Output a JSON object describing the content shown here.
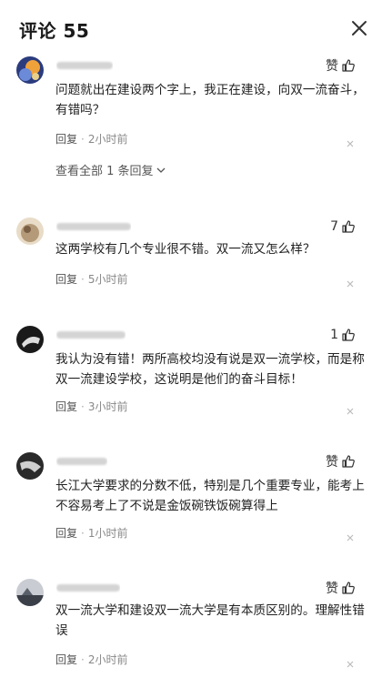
{
  "header": {
    "title": "评论 55"
  },
  "reply_label": "回复",
  "comments": [
    {
      "likes": "赞",
      "text": "问题就出在建设两个字上，我正在建设，向双一流奋斗，有错吗？",
      "time": "2小时前",
      "view_all": "查看全部 1 条回复"
    },
    {
      "likes": "7",
      "text": "这两学校有几个专业很不错。双一流又怎么样？",
      "time": "5小时前"
    },
    {
      "likes": "1",
      "text": "我认为没有错！两所高校均没有说是双一流学校，而是称双一流建设学校，这说明是他们的奋斗目标！",
      "time": "3小时前"
    },
    {
      "likes": "赞",
      "text": "长江大学要求的分数不低，特别是几个重要专业，能考上不容易考上了不说是金饭碗铁饭碗算得上",
      "time": "1小时前"
    },
    {
      "likes": "赞",
      "text": "双一流大学和建设双一流大学是有本质区别的。理解性错误",
      "time": "2小时前"
    }
  ]
}
